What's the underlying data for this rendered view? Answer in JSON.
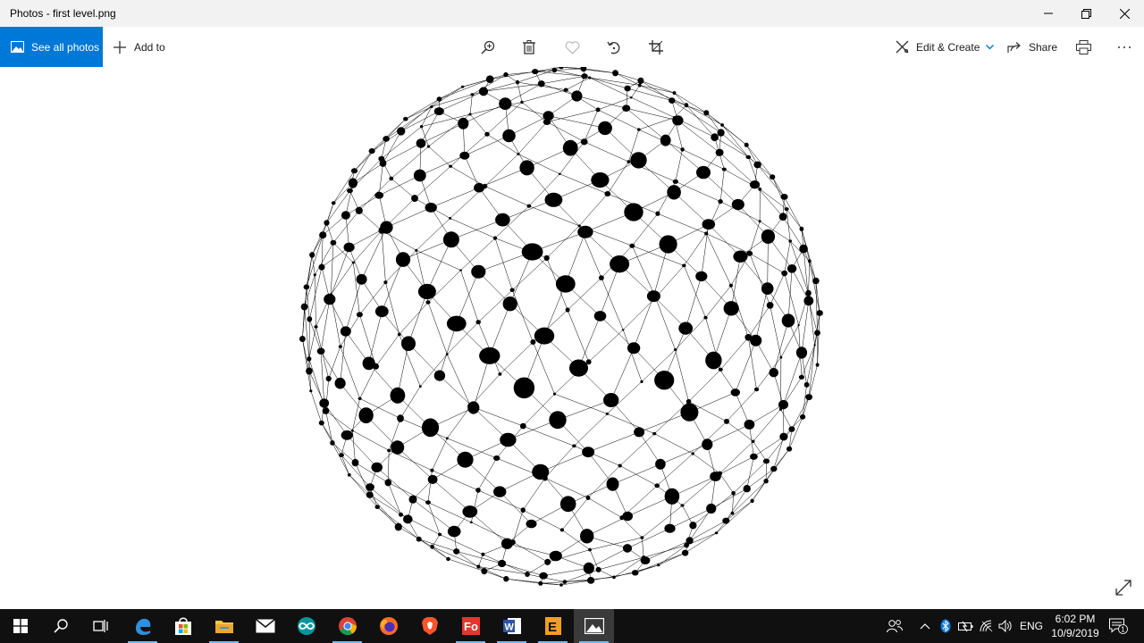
{
  "window": {
    "title": "Photos - first level.png",
    "minimize_icon": "minimize-icon",
    "maximize_icon": "restore-icon",
    "close_icon": "close-icon"
  },
  "toolbar": {
    "see_all_label": "See all photos",
    "add_to_label": "Add to",
    "zoom_icon": "zoom-icon",
    "delete_icon": "trash-icon",
    "favorite_icon": "heart-icon",
    "rotate_icon": "rotate-icon",
    "crop_icon": "crop-icon",
    "edit_create_label": "Edit & Create",
    "share_label": "Share",
    "print_icon": "print-icon",
    "more_icon": "more-icon"
  },
  "viewer": {
    "image_subject": "network sphere of connected black dots",
    "expand_icon": "expand-icon"
  },
  "taskbar": {
    "apps": [
      "windows-start-icon",
      "search-icon",
      "task-view-icon",
      "edge-icon",
      "store-icon",
      "file-explorer-icon",
      "mail-icon",
      "arduino-icon",
      "chrome-icon",
      "firefox-icon",
      "brave-icon",
      "foxit-icon",
      "word-icon",
      "e-app-icon",
      "photos-icon"
    ],
    "active_app": "photos-icon",
    "language": "ENG",
    "time": "6:02 PM",
    "date": "10/9/2019",
    "notification_count": "1"
  },
  "colors": {
    "accent": "#0078d7",
    "taskbar": "#101010",
    "titlebar": "#f2f2f2"
  }
}
